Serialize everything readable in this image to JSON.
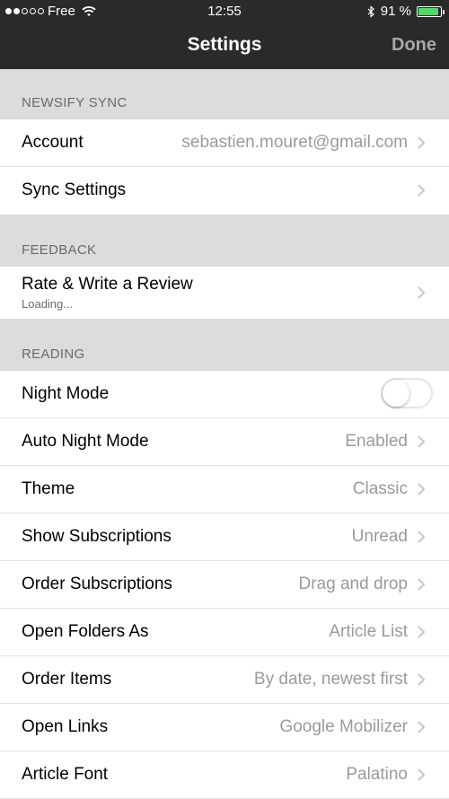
{
  "statusbar": {
    "carrier": "Free",
    "time": "12:55",
    "battery": "91 %",
    "battery_level": 0.91,
    "signal_bars": 2
  },
  "navbar": {
    "title": "Settings",
    "done_label": "Done"
  },
  "sections": {
    "sync": {
      "header": "NEWSIFY SYNC",
      "account_label": "Account",
      "account_value": "sebastien.mouret@gmail.com",
      "sync_settings_label": "Sync Settings"
    },
    "feedback": {
      "header": "FEEDBACK",
      "rate_label": "Rate & Write a Review",
      "rate_sub": "Loading..."
    },
    "reading": {
      "header": "READING",
      "night_mode_label": "Night Mode",
      "night_mode_on": false,
      "auto_night_label": "Auto Night Mode",
      "auto_night_value": "Enabled",
      "theme_label": "Theme",
      "theme_value": "Classic",
      "show_subs_label": "Show Subscriptions",
      "show_subs_value": "Unread",
      "order_subs_label": "Order Subscriptions",
      "order_subs_value": "Drag and drop",
      "open_folders_label": "Open Folders As",
      "open_folders_value": "Article List",
      "order_items_label": "Order Items",
      "order_items_value": "By date, newest first",
      "open_links_label": "Open Links",
      "open_links_value": "Google Mobilizer",
      "article_font_label": "Article Font",
      "article_font_value": "Palatino"
    }
  },
  "colors": {
    "bar": "#2a2a2a",
    "section_bg": "#dadcdd",
    "battery": "#4cd964"
  }
}
